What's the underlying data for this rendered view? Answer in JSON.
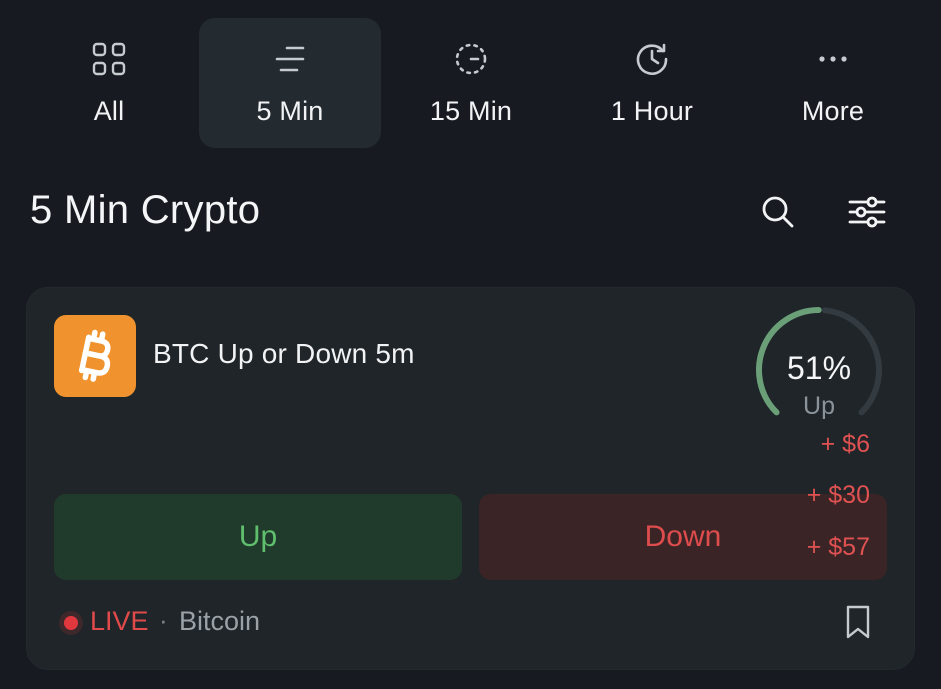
{
  "tabs": [
    {
      "label": "All",
      "icon": "grid-icon",
      "active": false
    },
    {
      "label": "5 Min",
      "icon": "lines-icon",
      "active": true
    },
    {
      "label": "15 Min",
      "icon": "dashed-timer-icon",
      "active": false
    },
    {
      "label": "1 Hour",
      "icon": "clock-history-icon",
      "active": false
    },
    {
      "label": "More",
      "icon": "ellipsis-icon",
      "active": false
    }
  ],
  "header": {
    "title": "5 Min Crypto",
    "search_icon": "search-icon",
    "filter_icon": "sliders-icon"
  },
  "market": {
    "title": "BTC Up or Down 5m",
    "logo_icon": "bitcoin-icon",
    "gauge": {
      "percent_label": "51%",
      "label": "Up",
      "value_fraction": 0.51
    },
    "up_label": "Up",
    "down_label": "Down",
    "payouts": [
      "+ $6",
      "+ $30",
      "+ $57"
    ],
    "live_label": "LIVE",
    "separator": "·",
    "category": "Bitcoin",
    "bookmark_icon": "bookmark-icon"
  },
  "colors": {
    "background": "#171b21",
    "card": "#1f2529",
    "up": "#5fbf6d",
    "down": "#df4c4c",
    "bitcoin": "#f0932e",
    "gauge_up": "#6a9f78",
    "gauge_track": "#343b40"
  }
}
